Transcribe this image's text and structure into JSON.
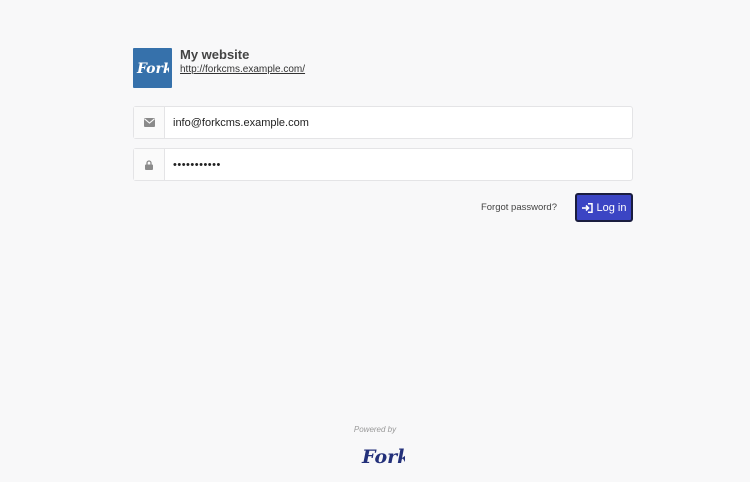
{
  "site": {
    "name": "My website",
    "url": "http://forkcms.example.com/",
    "logo_text": "Fork",
    "logo_color": "#3671ab"
  },
  "login_form": {
    "email": {
      "icon": "envelope-icon",
      "value": "info@forkcms.example.com"
    },
    "password": {
      "icon": "lock-icon",
      "value": "•••••••••••"
    },
    "forgot_password_label": "Forgot password?",
    "login_button_label": "Log in",
    "login_button_icon": "sign-in-icon",
    "accent_color": "#3b45c4"
  },
  "footer": {
    "powered_by_label": "Powered by",
    "logo_text": "Fork",
    "logo_color": "#23307a"
  }
}
